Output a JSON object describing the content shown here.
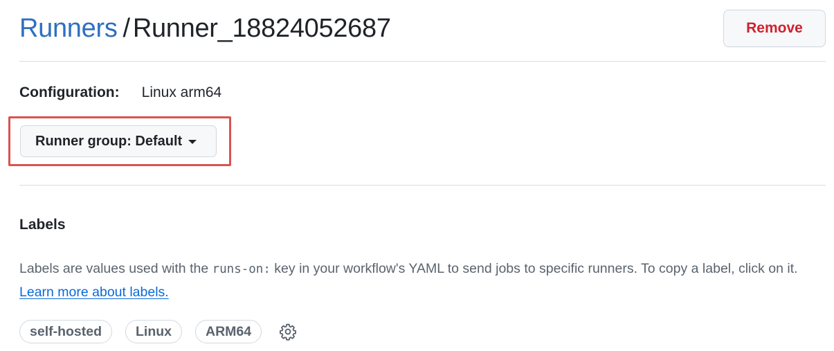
{
  "header": {
    "breadcrumb_link": "Runners",
    "separator": "/",
    "runner_name": "Runner_18824052687",
    "remove_label": "Remove"
  },
  "configuration": {
    "label": "Configuration:",
    "value": "Linux arm64"
  },
  "runner_group": {
    "label": "Runner group: Default"
  },
  "labels": {
    "heading": "Labels",
    "desc_before": "Labels are values used with the ",
    "desc_code": "runs-on:",
    "desc_after": " key in your workflow's YAML to send jobs to specific runners. To copy a label, click on it. ",
    "learn_more": "Learn more about labels.",
    "chips": [
      "self-hosted",
      "Linux",
      "ARM64"
    ],
    "settings_icon": "gear-icon"
  },
  "colors": {
    "link": "#2f6fbf",
    "danger": "#cf222e",
    "highlight": "#d9534f"
  }
}
